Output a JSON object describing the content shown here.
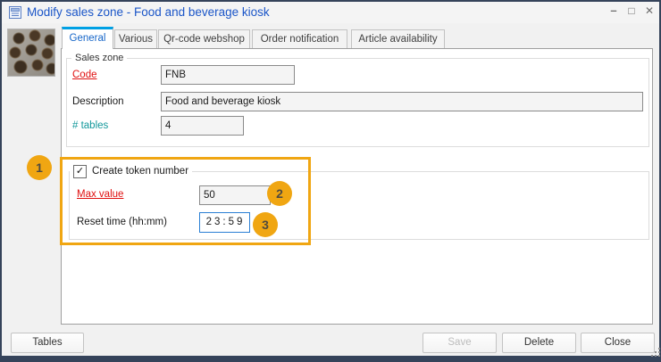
{
  "window": {
    "title": "Modify sales zone - Food and beverage kiosk",
    "controls": {
      "minimize": "–",
      "maximize": "□",
      "close": "✕"
    }
  },
  "tabs": [
    {
      "label": "General",
      "active": true
    },
    {
      "label": "Various",
      "active": false
    },
    {
      "label": "Qr-code webshop",
      "active": false
    },
    {
      "label": "Order notification",
      "active": false
    },
    {
      "label": "Article availability",
      "active": false
    }
  ],
  "form": {
    "sales_zone": {
      "legend": "Sales zone",
      "code": {
        "label": "Code",
        "value": "FNB",
        "required": true
      },
      "description": {
        "label": "Description",
        "value": "Food and beverage kiosk"
      },
      "tables": {
        "label": "# tables",
        "value": "4"
      }
    },
    "token": {
      "checkbox_label": "Create token number",
      "checked": true,
      "check_glyph": "✓",
      "max_value": {
        "label": "Max value",
        "value": "50",
        "required": true
      },
      "reset_time": {
        "label": "Reset time (hh:mm)",
        "value": "23:59"
      }
    }
  },
  "callouts": [
    "1",
    "2",
    "3"
  ],
  "footer": {
    "tables_button": "Tables",
    "save_button": "Save",
    "save_disabled": true,
    "delete_button": "Delete",
    "close_button": "Close"
  },
  "colors": {
    "highlight_orange": "#F0A612",
    "active_tab_blue": "#00A0E4",
    "required_label_red": "#E01010",
    "tables_label_teal": "#12989B",
    "title_blue": "#1B56C8",
    "focus_border_blue": "#2A7FD4"
  }
}
